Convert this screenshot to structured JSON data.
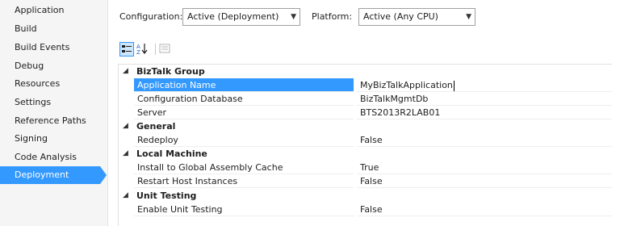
{
  "sidebar": {
    "items": [
      {
        "label": "Application"
      },
      {
        "label": "Build"
      },
      {
        "label": "Build Events"
      },
      {
        "label": "Debug"
      },
      {
        "label": "Resources"
      },
      {
        "label": "Settings"
      },
      {
        "label": "Reference Paths"
      },
      {
        "label": "Signing"
      },
      {
        "label": "Code Analysis"
      },
      {
        "label": "Deployment"
      }
    ],
    "selected": "Deployment"
  },
  "config": {
    "configuration_label": "Configuration:",
    "configuration_value": "Active (Deployment)",
    "platform_label": "Platform:",
    "platform_value": "Active (Any CPU)"
  },
  "toolbar": {
    "categorized": "categorized-view-icon",
    "alphabetical": "alphabetical-sort-icon",
    "property_pages": "property-pages-icon"
  },
  "property_grid": {
    "categories": [
      {
        "name": "BizTalk Group",
        "properties": [
          {
            "name": "Application Name",
            "value": "MyBizTalkApplication"
          },
          {
            "name": "Configuration Database",
            "value": "BizTalkMgmtDb"
          },
          {
            "name": "Server",
            "value": "BTS2013R2LAB01"
          }
        ]
      },
      {
        "name": "General",
        "properties": [
          {
            "name": "Redeploy",
            "value": "False"
          }
        ]
      },
      {
        "name": "Local Machine",
        "properties": [
          {
            "name": "Install to Global Assembly Cache",
            "value": "True"
          },
          {
            "name": "Restart Host Instances",
            "value": "False"
          }
        ]
      },
      {
        "name": "Unit Testing",
        "properties": [
          {
            "name": "Enable Unit Testing",
            "value": "False"
          }
        ]
      }
    ]
  },
  "colors": {
    "accent": "#3399ff"
  }
}
